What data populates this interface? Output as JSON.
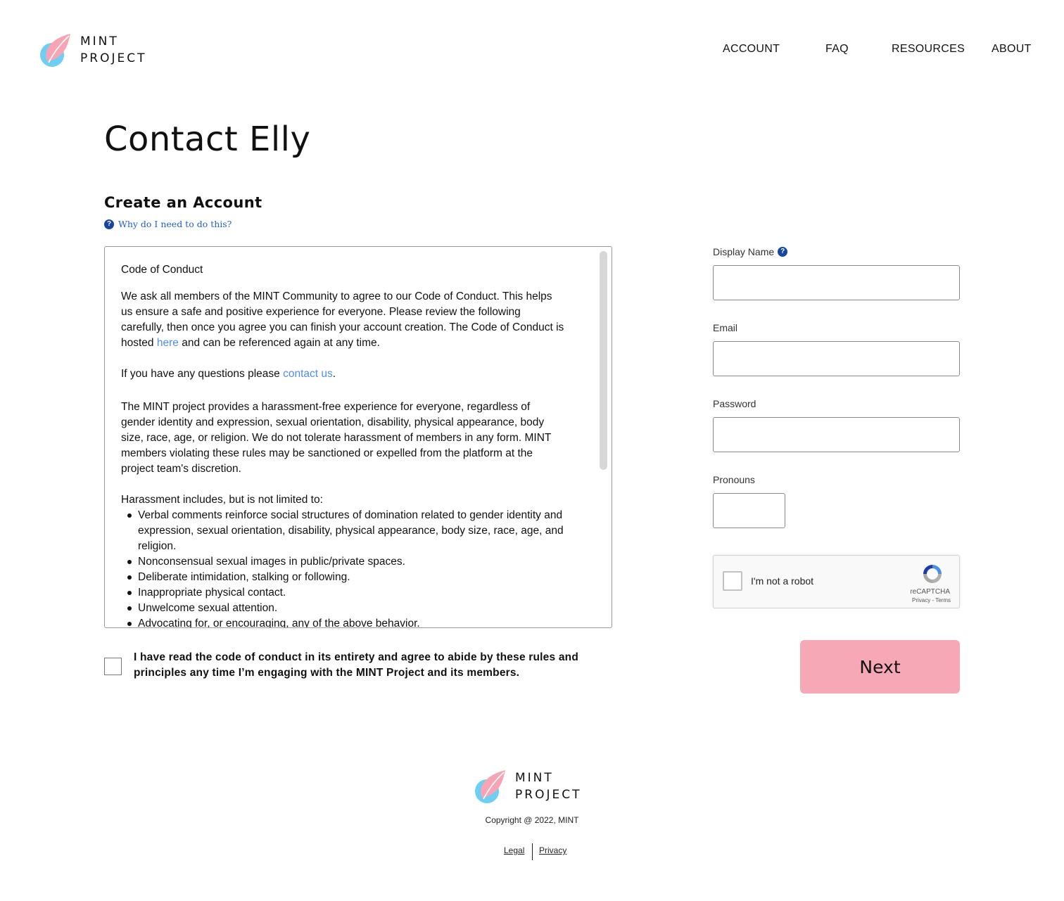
{
  "brand": {
    "line1": "MINT",
    "line2": "PROJECT"
  },
  "nav": {
    "account": "ACCOUNT",
    "faq": "FAQ",
    "resources": "RESOURCES",
    "about": "ABOUT"
  },
  "page_title": "Contact Elly",
  "section_title": "Create an Account",
  "why_link": "Why do I need to do this?",
  "code_of_conduct": {
    "heading": "Code of Conduct",
    "intro_1": "We ask all members of the MINT Community to agree to our Code of Conduct. This helps us ensure a safe and positive experience for everyone. Please review the following carefully, then once you agree you can finish your account creation. The Code of Conduct is hosted ",
    "intro_link": "here",
    "intro_2": " and can be referenced again at any time.",
    "questions_1": "If you have any questions please ",
    "questions_link": "contact us",
    "questions_2": ".",
    "policy": "The MINT project provides a harassment-free experience for everyone, regardless of gender identity and expression, sexual orientation, disability, physical appearance, body size, race, age, or religion. We do not tolerate harassment of members in any form. MINT members violating these rules may be sanctioned or expelled from the platform at the project team's discretion.",
    "harassment_intro": "Harassment includes, but is not limited to:",
    "harassment_items": [
      "Verbal comments reinforce social structures of domination related to gender identity and expression, sexual orientation, disability, physical appearance, body size, race, age, and religion.",
      "Nonconsensual sexual images in public/private spaces.",
      "Deliberate intimidation, stalking or following.",
      "Inappropriate physical contact.",
      "Unwelcome sexual attention.",
      "Advocating for, or encouraging, any of the above behavior."
    ]
  },
  "agreement": "I have read the code of conduct in its entirety and agree to abide by these rules and principles any time I’m engaging with the MINT Project and its members.",
  "form": {
    "display_name_label": "Display Name",
    "display_name_value": "",
    "email_label": "Email",
    "email_value": "",
    "password_label": "Password",
    "password_value": "",
    "pronouns_label": "Pronouns",
    "pronouns_value": ""
  },
  "recaptcha": {
    "label": "I'm not a robot",
    "brand": "reCAPTCHA",
    "privacy": "Privacy",
    "terms": "Terms"
  },
  "next_button": "Next",
  "footer": {
    "copyright": "Copyright @ 2022, MINT",
    "legal": "Legal",
    "privacy": "Privacy"
  },
  "colors": {
    "accent_pink": "#f6a8b6",
    "link_blue": "#4f8cf0",
    "help_blue": "#1746a2",
    "logo_pink": "#f7a4b5",
    "logo_blue": "#6ccff3"
  }
}
